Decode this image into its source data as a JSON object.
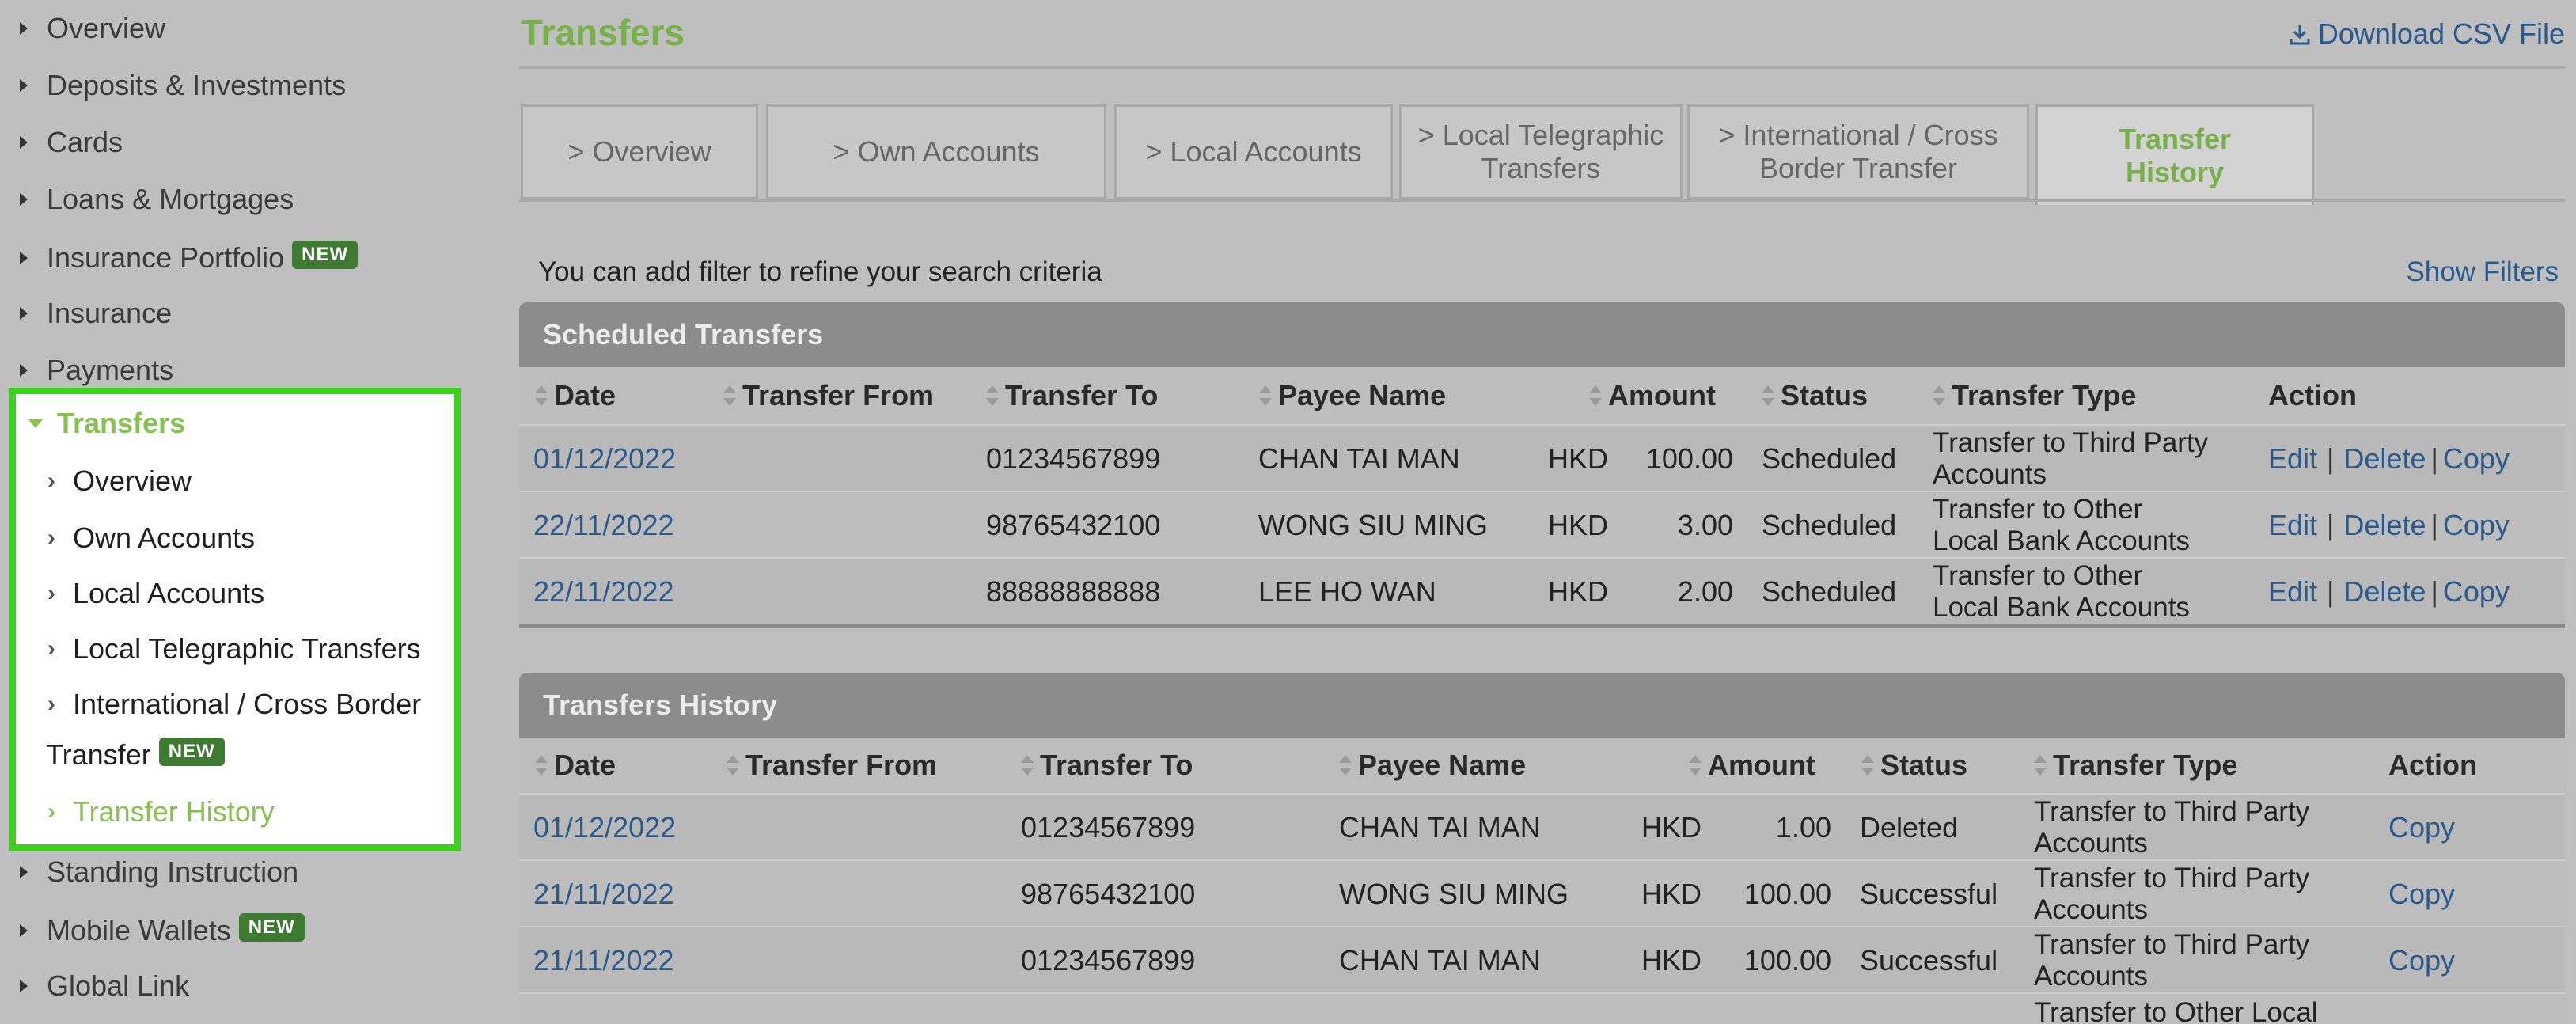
{
  "sidebar": {
    "items_top": [
      "Overview",
      "Deposits & Investments",
      "Cards",
      "Loans & Mortgages",
      "Insurance Portfolio",
      "Insurance",
      "Payments"
    ],
    "new_badge": "NEW",
    "transfers": {
      "label": "Transfers",
      "sub": [
        "Overview",
        "Own Accounts",
        "Local Accounts",
        "Local Telegraphic Transfers",
        "International / Cross Border",
        "Transfer",
        "Transfer History"
      ]
    },
    "items_bottom": [
      "Standing Instruction",
      "Mobile Wallets",
      "Global Link"
    ]
  },
  "main": {
    "title": "Transfers",
    "download_csv": "Download CSV File",
    "tabs": [
      {
        "line1": "> Overview",
        "line2": ""
      },
      {
        "line1": "> Own Accounts",
        "line2": ""
      },
      {
        "line1": "> Local Accounts",
        "line2": ""
      },
      {
        "line1": "> Local Telegraphic",
        "line2": "Transfers"
      },
      {
        "line1": "> International / Cross",
        "line2": "Border Transfer"
      },
      {
        "line1": "Transfer",
        "line2": "History"
      }
    ],
    "filter_hint": "You can add filter to refine your search criteria",
    "show_filters": "Show Filters",
    "scheduled": {
      "title": "Scheduled Transfers",
      "columns": [
        "Date",
        "Transfer From",
        "Transfer To",
        "Payee Name",
        "Amount",
        "Status",
        "Transfer Type",
        "Action"
      ],
      "rows": [
        {
          "date": "01/12/2022",
          "from": "",
          "to": "01234567899",
          "payee": "CHAN TAI MAN",
          "ccy": "HKD",
          "amount": "100.00",
          "status": "Scheduled",
          "type1": "Transfer to Third Party",
          "type2": "Accounts"
        },
        {
          "date": "22/11/2022",
          "from": "",
          "to": "98765432100",
          "payee": "WONG SIU MING",
          "ccy": "HKD",
          "amount": "3.00",
          "status": "Scheduled",
          "type1": "Transfer to Other",
          "type2": "Local Bank Accounts"
        },
        {
          "date": "22/11/2022",
          "from": "",
          "to": "88888888888",
          "payee": "LEE HO WAN",
          "ccy": "HKD",
          "amount": "2.00",
          "status": "Scheduled",
          "type1": "Transfer to Other",
          "type2": "Local Bank Accounts"
        }
      ],
      "actions": {
        "edit": "Edit",
        "delete": "Delete",
        "copy": "Copy",
        "sep": "|"
      }
    },
    "history": {
      "title": "Transfers History",
      "columns": [
        "Date",
        "Transfer From",
        "Transfer To",
        "Payee Name",
        "Amount",
        "Status",
        "Transfer Type",
        "Action"
      ],
      "rows": [
        {
          "date": "01/12/2022",
          "from": "",
          "to": "01234567899",
          "payee": "CHAN TAI MAN",
          "ccy": "HKD",
          "amount": "1.00",
          "status": "Deleted",
          "type1": "Transfer to Third Party",
          "type2": "Accounts"
        },
        {
          "date": "21/11/2022",
          "from": "",
          "to": "98765432100",
          "payee": "WONG SIU MING",
          "ccy": "HKD",
          "amount": "100.00",
          "status": "Successful",
          "type1": "Transfer to Third Party",
          "type2": "Accounts"
        },
        {
          "date": "21/11/2022",
          "from": "",
          "to": "01234567899",
          "payee": "CHAN TAI MAN",
          "ccy": "HKD",
          "amount": "100.00",
          "status": "Successful",
          "type1": "Transfer to Third Party",
          "type2": "Accounts"
        }
      ],
      "partial_row_type": "Transfer to Other Local",
      "actions": {
        "copy": "Copy"
      }
    }
  },
  "colors": {
    "accent_green": "#78b04a",
    "link_blue": "#2a5a8c",
    "highlight_border": "#3cd11b",
    "badge_green": "#3f7a33"
  }
}
